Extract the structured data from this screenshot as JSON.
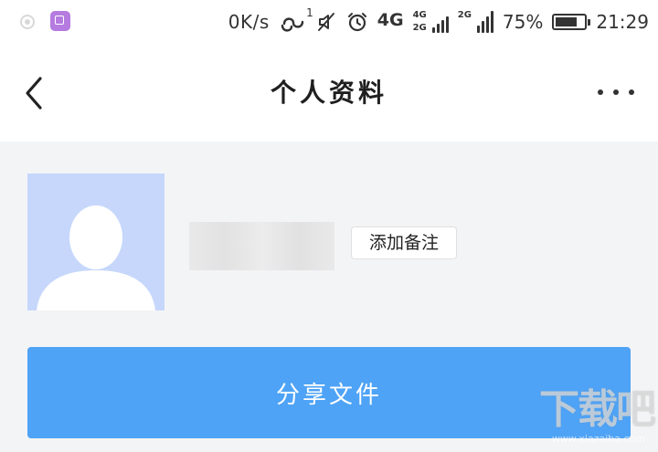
{
  "status_bar": {
    "net_speed": "0K/s",
    "loop_badge": "1",
    "network_type": "4G",
    "sim1_labels": [
      "4G",
      "2G"
    ],
    "sim2_label": "2G",
    "battery_percent": "75%",
    "battery_level": 0.75,
    "time": "21:29",
    "icons": [
      "notification-dot-icon",
      "gallery-icon",
      "loop-icon",
      "mute-icon",
      "alarm-icon",
      "signal-icon",
      "battery-icon"
    ]
  },
  "header": {
    "title": "个人资料",
    "back_icon": "chevron-left-icon",
    "more_icon": "more-horizontal-icon"
  },
  "profile": {
    "avatar_icon": "default-avatar-icon",
    "add_remark_label": "添加备注"
  },
  "actions": {
    "share_label": "分享文件"
  },
  "colors": {
    "primary_button": "#4ea3f6",
    "avatar_bg": "#c6d7fb",
    "page_bg": "#f3f4f6",
    "header_bg": "#ffffff"
  },
  "watermark": {
    "logo_text": "下载吧",
    "url": "www.xiazaiba.com"
  }
}
